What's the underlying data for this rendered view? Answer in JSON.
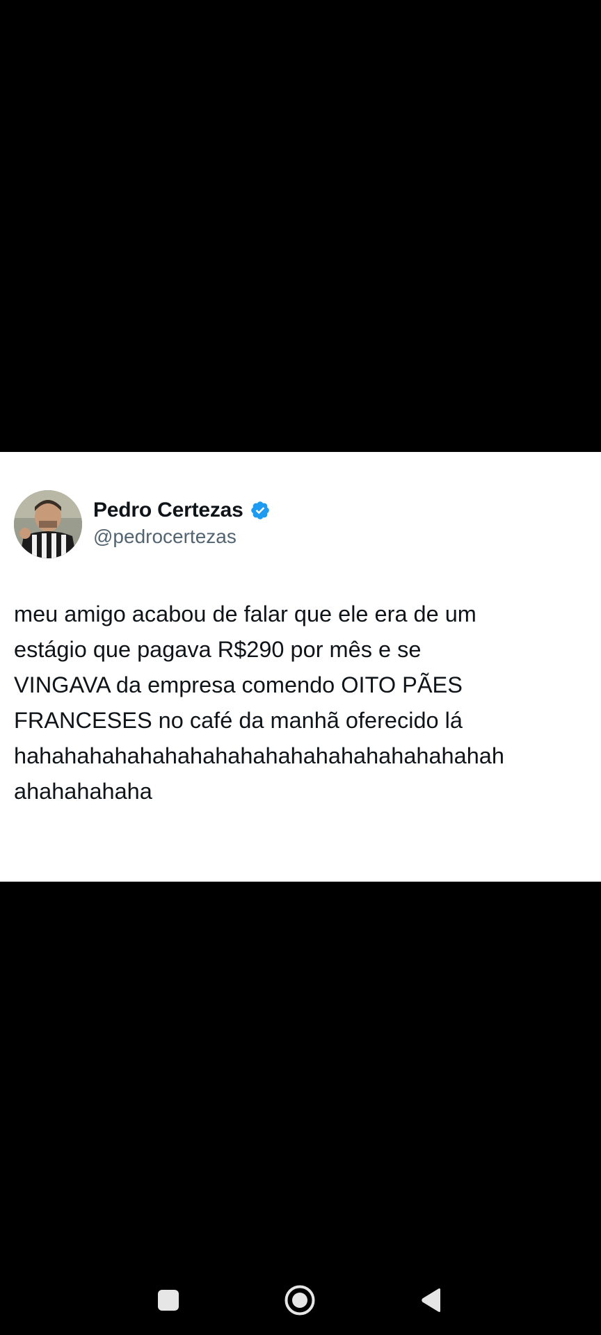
{
  "tweet": {
    "author_name": "Pedro Certezas",
    "author_handle": "@pedrocertezas",
    "verified": true,
    "text_lines": [
      "meu amigo acabou de falar que ele era de um",
      "estágio que pagava R$290 por mês e se",
      "VINGAVA da empresa comendo OITO PÃES",
      "FRANCESES no café da manhã oferecido lá",
      "hahahahahahahahahahahahahahahahahahahah",
      "ahahahahaha"
    ]
  },
  "colors": {
    "background": "#000000",
    "card": "#ffffff",
    "text_primary": "#0f1419",
    "text_secondary": "#536471",
    "verified_blue": "#1d9bf0",
    "nav_icon": "#e6e6e6"
  },
  "icons": {
    "verified": "verified-badge-icon",
    "recents": "recents-square-icon",
    "home": "home-circle-icon",
    "back": "back-triangle-icon"
  }
}
